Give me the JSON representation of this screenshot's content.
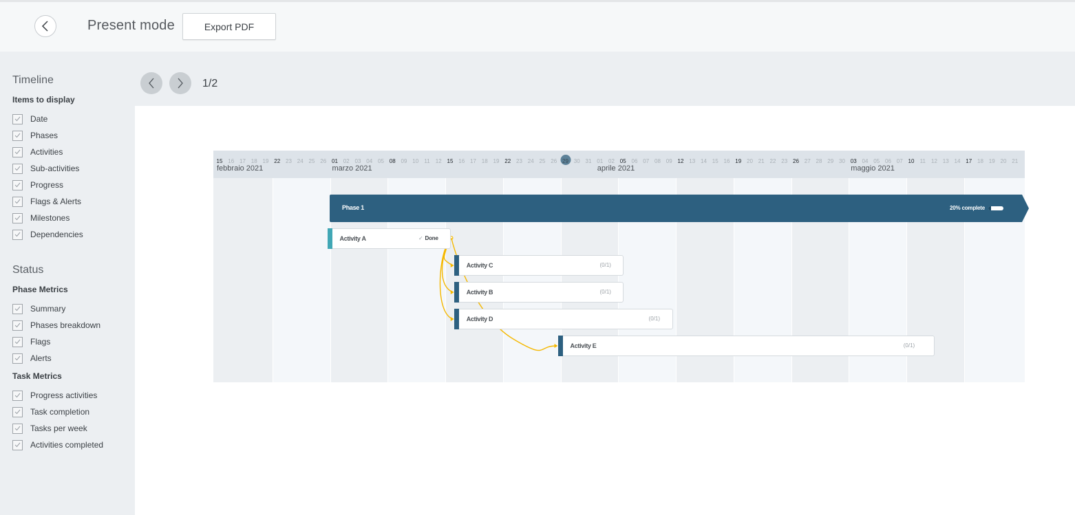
{
  "header": {
    "title": "Present mode",
    "back_icon": "chevron-left-icon",
    "export_label": "Export PDF"
  },
  "sidebar": {
    "timeline": {
      "title": "Timeline",
      "subtitle": "Items to display",
      "items": [
        {
          "label": "Date",
          "checked": true
        },
        {
          "label": "Phases",
          "checked": true
        },
        {
          "label": "Activities",
          "checked": true
        },
        {
          "label": "Sub-activities",
          "checked": true
        },
        {
          "label": "Progress",
          "checked": true
        },
        {
          "label": "Flags & Alerts",
          "checked": true
        },
        {
          "label": "Milestones",
          "checked": true
        },
        {
          "label": "Dependencies",
          "checked": true
        }
      ]
    },
    "status": {
      "title": "Status",
      "phase_metrics": {
        "title": "Phase Metrics",
        "items": [
          {
            "label": "Summary",
            "checked": true
          },
          {
            "label": "Phases breakdown",
            "checked": true
          },
          {
            "label": "Flags",
            "checked": true
          },
          {
            "label": "Alerts",
            "checked": true
          }
        ]
      },
      "task_metrics": {
        "title": "Task Metrics",
        "items": [
          {
            "label": "Progress activities",
            "checked": true
          },
          {
            "label": "Task completion",
            "checked": true
          },
          {
            "label": "Tasks per week",
            "checked": true
          },
          {
            "label": "Activities completed",
            "checked": true
          }
        ]
      }
    }
  },
  "pager": {
    "prev_icon": "chevron-left-icon",
    "next_icon": "chevron-right-icon",
    "indicator": "1/2"
  },
  "timeline": {
    "days": [
      "15",
      "16",
      "17",
      "18",
      "19",
      "22",
      "23",
      "24",
      "25",
      "26",
      "01",
      "02",
      "03",
      "04",
      "05",
      "08",
      "09",
      "10",
      "11",
      "12",
      "15",
      "16",
      "17",
      "18",
      "19",
      "22",
      "23",
      "24",
      "25",
      "26",
      "29",
      "30",
      "31",
      "01",
      "02",
      "05",
      "06",
      "07",
      "08",
      "09",
      "12",
      "13",
      "14",
      "15",
      "16",
      "19",
      "20",
      "21",
      "22",
      "23",
      "26",
      "27",
      "28",
      "29",
      "30",
      "03",
      "04",
      "05",
      "06",
      "07",
      "10",
      "11",
      "12",
      "13",
      "14",
      "17",
      "18",
      "19",
      "20",
      "21"
    ],
    "week_starts": [
      0,
      5,
      10,
      15,
      20,
      25,
      30,
      35,
      40,
      45,
      50,
      55,
      60,
      65
    ],
    "today_index": 30,
    "months": [
      {
        "label": "febbraio 2021",
        "start_index": 0
      },
      {
        "label": "marzo 2021",
        "start_index": 10
      },
      {
        "label": "aprile 2021",
        "start_index": 33
      },
      {
        "label": "maggio 2021",
        "start_index": 55
      }
    ],
    "colors": {
      "phase": "#2d6080",
      "activity_done": "#41a7b5",
      "activity": "#2d6080",
      "dependency": "#f5b800",
      "today": "#5c8198"
    }
  },
  "phase": {
    "name": "Phase 1",
    "progress_label": "20% complete",
    "progress": 0.2
  },
  "activities": [
    {
      "id": "A",
      "name": "Activity A",
      "status": "Done",
      "status_icon": "check-icon",
      "count": null,
      "start": 10,
      "end": 20.7,
      "row": 0,
      "done": true
    },
    {
      "id": "C",
      "name": "Activity C",
      "status": null,
      "count": "(0/1)",
      "start": 21,
      "end": 35.7,
      "row": 1,
      "done": false
    },
    {
      "id": "B",
      "name": "Activity B",
      "status": null,
      "count": "(0/1)",
      "start": 21,
      "end": 35.7,
      "row": 2,
      "done": false
    },
    {
      "id": "D",
      "name": "Activity D",
      "status": null,
      "count": "(0/1)",
      "start": 21,
      "end": 40,
      "row": 3,
      "done": false
    },
    {
      "id": "E",
      "name": "Activity E",
      "status": null,
      "count": "(0/1)",
      "start": 30,
      "end": 62.7,
      "row": 4,
      "done": false
    }
  ],
  "dependencies": [
    {
      "from": "A",
      "to": "C"
    },
    {
      "from": "A",
      "to": "B"
    },
    {
      "from": "A",
      "to": "D"
    },
    {
      "from": "A",
      "to": "E"
    }
  ]
}
